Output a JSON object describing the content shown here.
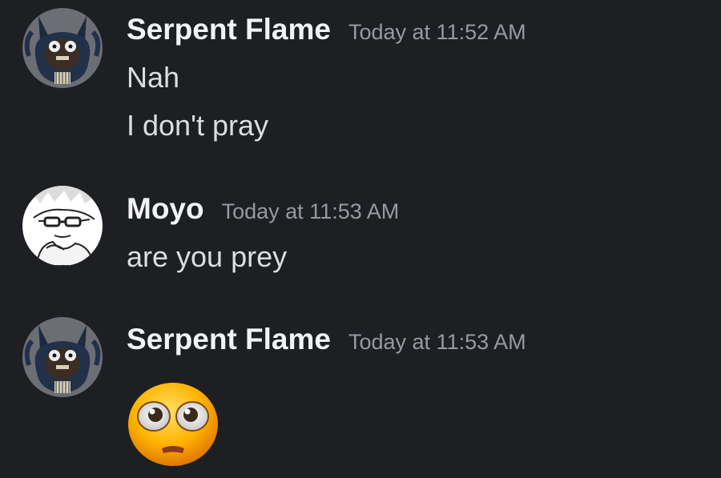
{
  "messages": [
    {
      "author": "Serpent Flame",
      "timestamp": "Today at 11:52 AM",
      "lines": [
        "Nah",
        "I don't pray"
      ]
    },
    {
      "author": "Moyo",
      "timestamp": "Today at 11:53 AM",
      "lines": [
        "are you prey"
      ]
    },
    {
      "author": "Serpent Flame",
      "timestamp": "Today at 11:53 AM",
      "emoji": "pleading-face-emoji"
    }
  ],
  "colors": {
    "background": "#1e1f22",
    "username": "#f2f3f5",
    "timestamp": "#949ba4",
    "message_text": "#dbdee1"
  }
}
